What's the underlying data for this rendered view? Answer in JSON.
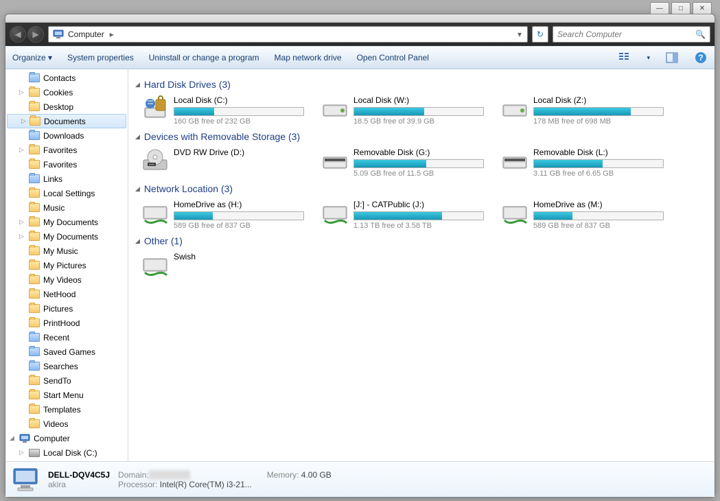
{
  "window_controls": {
    "min": "—",
    "max": "□",
    "close": "✕"
  },
  "nav": {
    "breadcrumb": "Computer",
    "refresh": "↻",
    "search_placeholder": "Search Computer"
  },
  "toolbar": {
    "organize": "Organize ▾",
    "system_properties": "System properties",
    "uninstall": "Uninstall or change a program",
    "map_drive": "Map network drive",
    "control_panel": "Open Control Panel",
    "view_chev": "▾",
    "help": "?"
  },
  "sidebar": {
    "items": [
      {
        "label": "Contacts",
        "icon": "special"
      },
      {
        "label": "Cookies",
        "icon": "folder",
        "arrow": true
      },
      {
        "label": "Desktop",
        "icon": "folder"
      },
      {
        "label": "Documents",
        "icon": "folder",
        "selected": true,
        "arrow": true
      },
      {
        "label": "Downloads",
        "icon": "special"
      },
      {
        "label": "Favorites",
        "icon": "folder",
        "arrow": true
      },
      {
        "label": "Favorites",
        "icon": "folder"
      },
      {
        "label": "Links",
        "icon": "special"
      },
      {
        "label": "Local Settings",
        "icon": "folder"
      },
      {
        "label": "Music",
        "icon": "folder"
      },
      {
        "label": "My Documents",
        "icon": "folder",
        "arrow": true
      },
      {
        "label": "My Documents",
        "icon": "folder",
        "arrow": true
      },
      {
        "label": "My Music",
        "icon": "folder"
      },
      {
        "label": "My Pictures",
        "icon": "folder"
      },
      {
        "label": "My Videos",
        "icon": "folder"
      },
      {
        "label": "NetHood",
        "icon": "folder"
      },
      {
        "label": "Pictures",
        "icon": "folder"
      },
      {
        "label": "PrintHood",
        "icon": "folder"
      },
      {
        "label": "Recent",
        "icon": "special"
      },
      {
        "label": "Saved Games",
        "icon": "special"
      },
      {
        "label": "Searches",
        "icon": "special"
      },
      {
        "label": "SendTo",
        "icon": "folder"
      },
      {
        "label": "Start Menu",
        "icon": "folder"
      },
      {
        "label": "Templates",
        "icon": "folder"
      },
      {
        "label": "Videos",
        "icon": "folder"
      }
    ],
    "computer": "Computer",
    "local_disk_c": "Local Disk (C:)"
  },
  "sections": [
    {
      "title": "Hard Disk Drives (3)",
      "drives": [
        {
          "label": "Local Disk (C:)",
          "sub": "160 GB free of 232 GB",
          "fill": 31,
          "icon": "hdd-lock"
        },
        {
          "label": "Local Disk (W:)",
          "sub": "18.5 GB free of 39.9 GB",
          "fill": 54,
          "icon": "hdd"
        },
        {
          "label": "Local Disk (Z:)",
          "sub": "178 MB free of 698 MB",
          "fill": 75,
          "icon": "hdd"
        }
      ]
    },
    {
      "title": "Devices with Removable Storage (3)",
      "drives": [
        {
          "label": "DVD RW Drive (D:)",
          "sub": "",
          "fill": -1,
          "icon": "dvd"
        },
        {
          "label": "Removable Disk (G:)",
          "sub": "5.09 GB free of 11.5 GB",
          "fill": 56,
          "icon": "removable"
        },
        {
          "label": "Removable Disk (L:)",
          "sub": "3.11 GB free of 6.65 GB",
          "fill": 53,
          "icon": "removable"
        }
      ]
    },
    {
      "title": "Network Location (3)",
      "drives": [
        {
          "label": "HomeDrive as (H:)",
          "sub": "589 GB free of 837 GB",
          "fill": 30,
          "icon": "netdrive"
        },
        {
          "label": "[J:] - CATPublic (J:)",
          "sub": "1.13 TB free of 3.58 TB",
          "fill": 68,
          "icon": "netdrive"
        },
        {
          "label": "HomeDrive as (M:)",
          "sub": "589 GB free of 837 GB",
          "fill": 30,
          "icon": "netdrive"
        }
      ]
    },
    {
      "title": "Other (1)",
      "drives": [
        {
          "label": "Swish",
          "sub": "",
          "fill": -1,
          "icon": "netdrive"
        }
      ]
    }
  ],
  "status": {
    "computer_name": "DELL-DQV4C5J",
    "user": "akira",
    "domain_lbl": "Domain:",
    "domain_val": " ",
    "memory_lbl": "Memory:",
    "memory_val": "4.00 GB",
    "processor_lbl": "Processor:",
    "processor_val": "Intel(R) Core(TM) i3-21..."
  }
}
